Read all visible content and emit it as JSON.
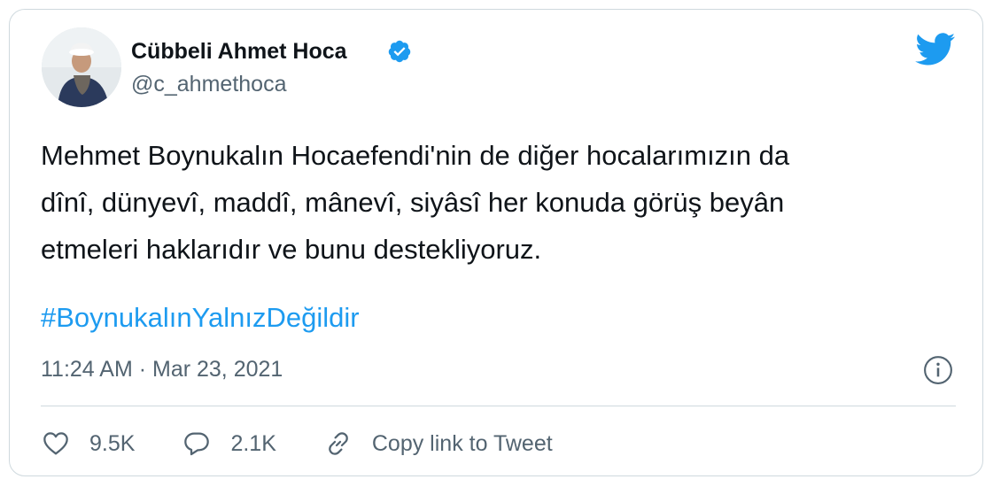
{
  "author": {
    "name": "Cübbeli Ahmet Hoca",
    "handle": "@c_ahmethoca",
    "verified": true
  },
  "tweet": {
    "lines": [
      "Mehmet Boynukalın Hocaefendi'nin de diğer hocalarımızın da",
      "dînî, dünyevî, maddî, mânevî, siyâsî her konuda görüş beyân",
      "etmeleri haklarıdır ve bunu destekliyoruz."
    ],
    "hashtag": "#BoynukalınYalnızDeğildir",
    "timestamp": "11:24 AM · Mar 23, 2021"
  },
  "actions": {
    "likes": "9.5K",
    "replies": "2.1K",
    "copy_link": "Copy link to Tweet"
  },
  "colors": {
    "brand": "#1d9bf0",
    "text": "#0f1419",
    "muted": "#536471",
    "border": "#cfd9de"
  },
  "icons": [
    "verified-badge-icon",
    "twitter-bird-icon",
    "info-icon",
    "heart-icon",
    "speech-bubble-icon",
    "link-icon"
  ]
}
